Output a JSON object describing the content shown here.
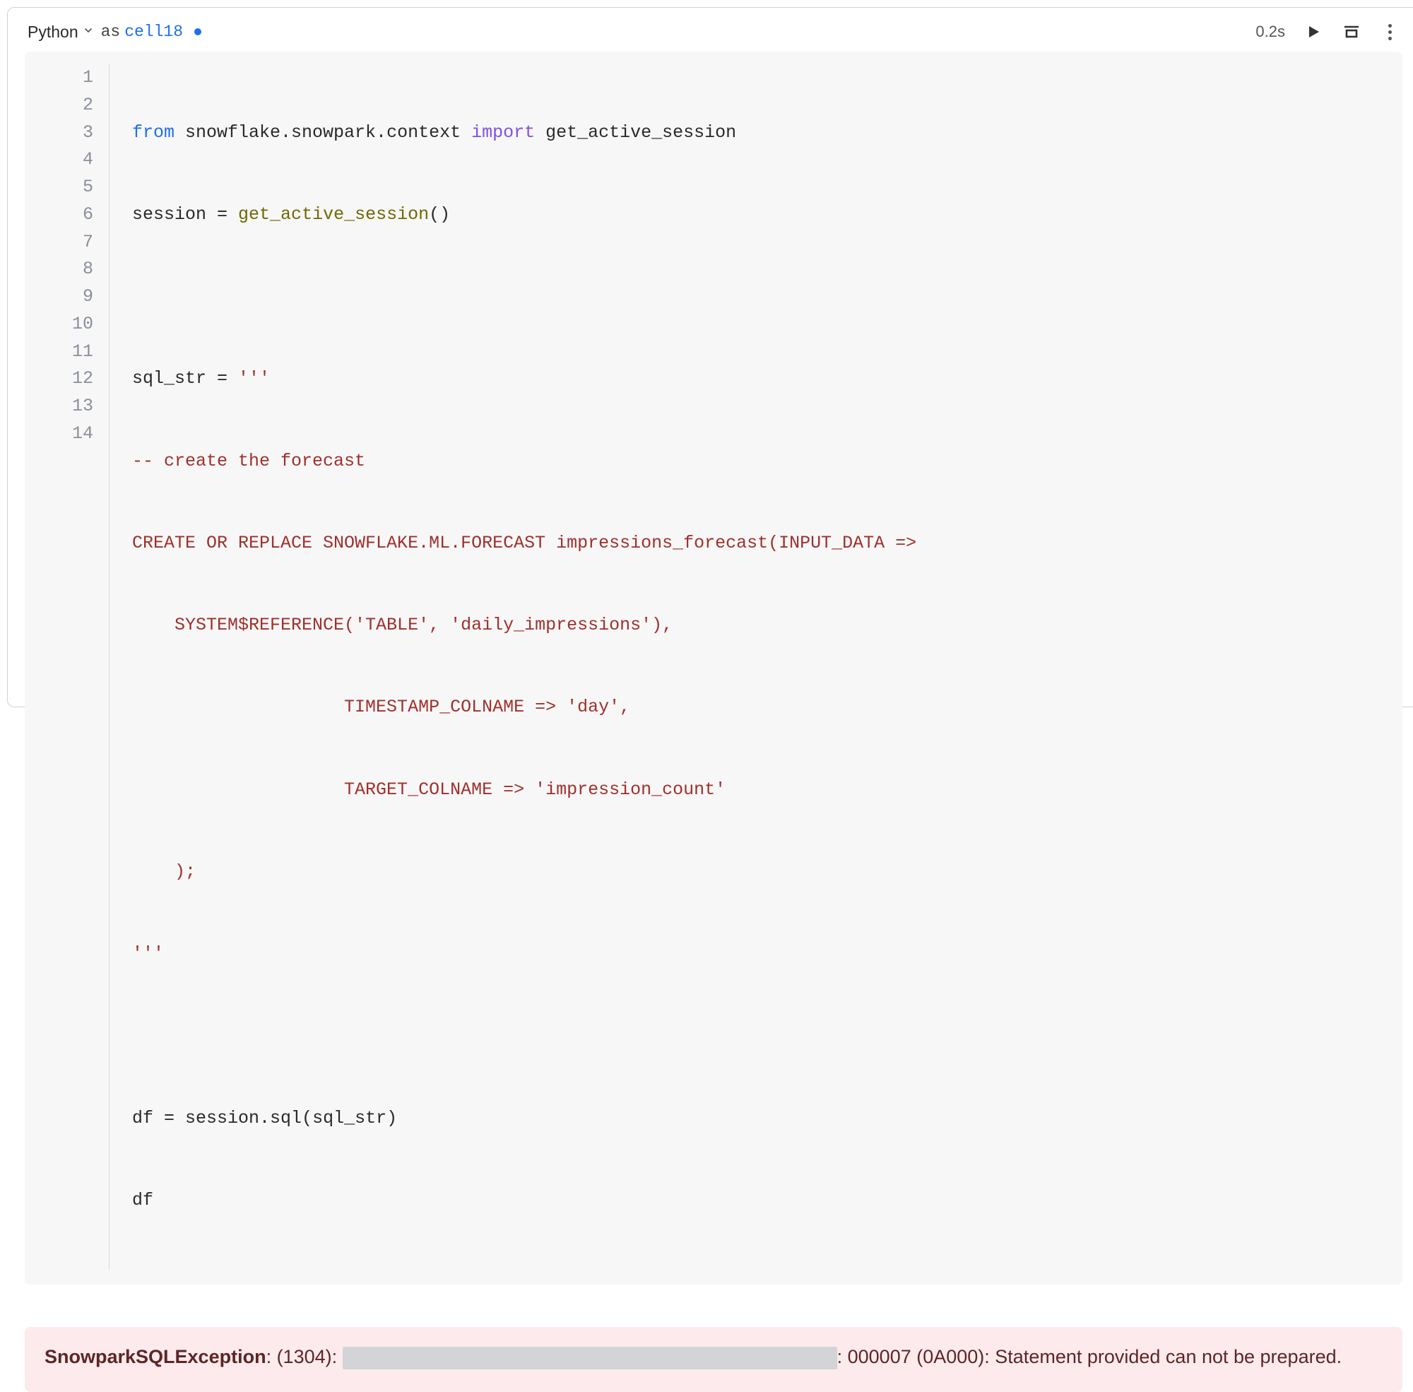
{
  "header": {
    "lang": "Python",
    "as_label": "as",
    "cell_name": "cell18",
    "exec_time": "0.2s"
  },
  "gutter": [
    "1",
    "2",
    "3",
    "4",
    "5",
    "6",
    "7",
    "8",
    "9",
    "10",
    "11",
    "12",
    "13",
    "14"
  ],
  "code": {
    "l1_from": "from",
    "l1_mod": " snowflake.snowpark.context ",
    "l1_imp": "import",
    "l1_name": " get_active_session",
    "l2_lhs": "session ",
    "l2_eq": "=",
    "l2_fn": " get_active_session",
    "l2_par": "()",
    "l4_lhs": "sql_str ",
    "l4_eq": "=",
    "l4_str": " '''",
    "l5": "-- create the forecast",
    "l6": "CREATE OR REPLACE SNOWFLAKE.ML.FORECAST impressions_forecast(INPUT_DATA =>",
    "l7": "    SYSTEM$REFERENCE('TABLE', 'daily_impressions'),",
    "l8": "                    TIMESTAMP_COLNAME => 'day',",
    "l9": "                    TARGET_COLNAME => 'impression_count'",
    "l10": "    );",
    "l11": "'''",
    "l13_lhs": "df ",
    "l13_eq": "=",
    "l13_rhs": " session.sql(sql_str)",
    "l14": "df"
  },
  "error": {
    "kind": "SnowparkSQLException",
    "codepart": ": (1304): ",
    "tail": ": 000007 (0A000): Statement provided can not be prepared."
  }
}
